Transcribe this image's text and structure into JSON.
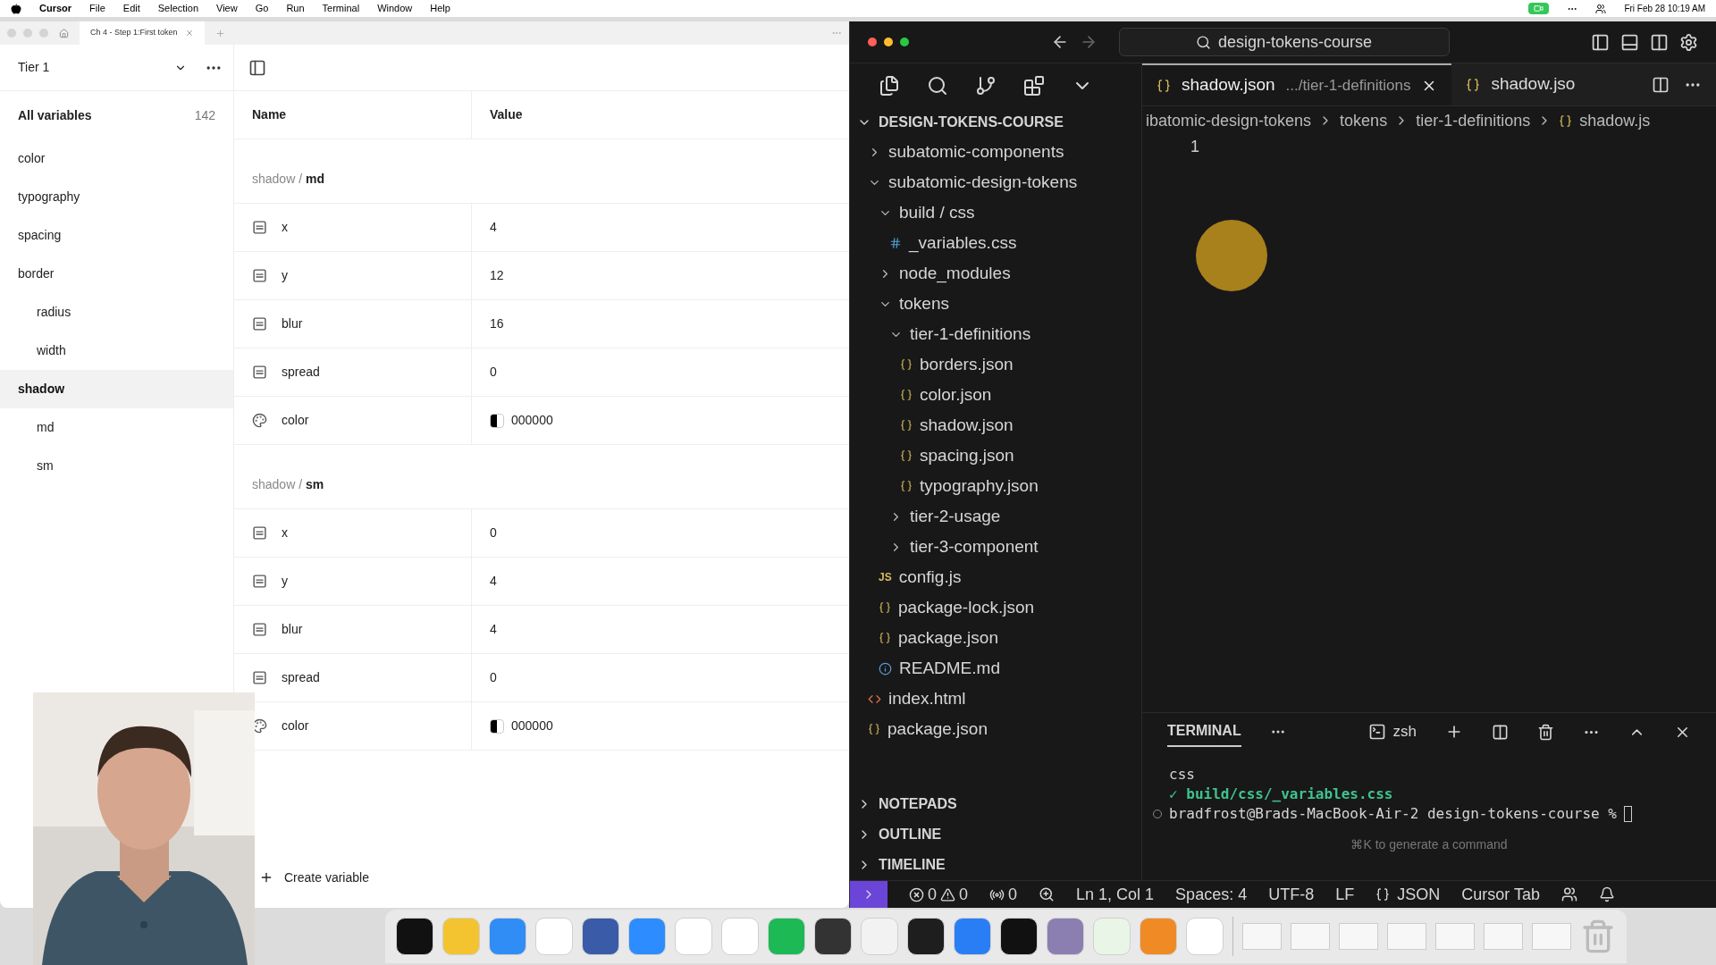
{
  "menu_bar": {
    "app": "Cursor",
    "items": [
      "File",
      "Edit",
      "Selection",
      "View",
      "Go",
      "Run",
      "Terminal",
      "Window",
      "Help"
    ],
    "clock": "Fri Feb 28  10:19 AM"
  },
  "variables_app": {
    "tab_title": "Ch 4 - Step 1:First token",
    "collection": "Tier 1",
    "sidebar": {
      "all_label": "All variables",
      "all_count": "142",
      "groups": [
        {
          "label": "color",
          "selected": false
        },
        {
          "label": "typography",
          "selected": false
        },
        {
          "label": "spacing",
          "selected": false
        },
        {
          "label": "border",
          "selected": false,
          "children": [
            {
              "label": "radius",
              "selected": false
            },
            {
              "label": "width",
              "selected": false
            }
          ]
        },
        {
          "label": "shadow",
          "selected": true,
          "children": [
            {
              "label": "md",
              "selected": false
            },
            {
              "label": "sm",
              "selected": false
            }
          ]
        }
      ]
    },
    "columns": [
      "Name",
      "Value"
    ],
    "groups": [
      {
        "path": "shadow /",
        "name": "md",
        "rows": [
          {
            "kind": "number",
            "name": "x",
            "value": "4"
          },
          {
            "kind": "number",
            "name": "y",
            "value": "12"
          },
          {
            "kind": "number",
            "name": "blur",
            "value": "16"
          },
          {
            "kind": "number",
            "name": "spread",
            "value": "0"
          },
          {
            "kind": "color",
            "name": "color",
            "value": "000000",
            "color": "#000000"
          }
        ]
      },
      {
        "path": "shadow /",
        "name": "sm",
        "rows": [
          {
            "kind": "number",
            "name": "x",
            "value": "0"
          },
          {
            "kind": "number",
            "name": "y",
            "value": "4"
          },
          {
            "kind": "number",
            "name": "blur",
            "value": "4"
          },
          {
            "kind": "number",
            "name": "spread",
            "value": "0"
          },
          {
            "kind": "color",
            "name": "color",
            "value": "000000",
            "color": "#000000"
          }
        ]
      }
    ],
    "create_button": "Create variable"
  },
  "editor": {
    "search": "design-tokens-course",
    "explorer": {
      "root": "DESIGN-TOKENS-COURSE",
      "tree": [
        {
          "kind": "folder",
          "label": "subatomic-components",
          "expanded": false
        },
        {
          "kind": "folder",
          "label": "subatomic-design-tokens",
          "expanded": true,
          "children": [
            {
              "kind": "folder",
              "label": "build / css",
              "expanded": true,
              "children": [
                {
                  "kind": "css",
                  "label": "_variables.css"
                }
              ]
            },
            {
              "kind": "folder",
              "label": "node_modules",
              "expanded": false
            },
            {
              "kind": "folder",
              "label": "tokens",
              "expanded": true,
              "children": [
                {
                  "kind": "folder",
                  "label": "tier-1-definitions",
                  "expanded": true,
                  "children": [
                    {
                      "kind": "json",
                      "label": "borders.json"
                    },
                    {
                      "kind": "json",
                      "label": "color.json"
                    },
                    {
                      "kind": "json",
                      "label": "shadow.json"
                    },
                    {
                      "kind": "json",
                      "label": "spacing.json"
                    },
                    {
                      "kind": "json",
                      "label": "typography.json"
                    }
                  ]
                },
                {
                  "kind": "folder",
                  "label": "tier-2-usage",
                  "expanded": false
                },
                {
                  "kind": "folder",
                  "label": "tier-3-component",
                  "expanded": false
                }
              ]
            },
            {
              "kind": "js",
              "icon_text": "JS",
              "label": "config.js"
            },
            {
              "kind": "json",
              "label": "package-lock.json"
            },
            {
              "kind": "json",
              "label": "package.json"
            },
            {
              "kind": "md",
              "label": "README.md"
            }
          ]
        },
        {
          "kind": "html",
          "label": "index.html"
        },
        {
          "kind": "json",
          "label": "package.json"
        }
      ],
      "sections": [
        "NOTEPADS",
        "OUTLINE",
        "TIMELINE"
      ]
    },
    "tabs": [
      {
        "label": "shadow.json",
        "description": ".../tier-1-definitions",
        "selected": true
      },
      {
        "label": "shadow.jso",
        "selected": false
      }
    ],
    "breadcrumbs": [
      "ibatomic-design-tokens",
      "tokens",
      "tier-1-definitions",
      "shadow.js"
    ],
    "line_numbers": [
      "1"
    ],
    "terminal": {
      "title": "TERMINAL",
      "shell": "zsh",
      "lines": [
        {
          "kind": "plain",
          "text": "css"
        },
        {
          "kind": "success",
          "text": "✓ build/css/_variables.css"
        },
        {
          "kind": "prompt",
          "text": "bradfrost@Brads-MacBook-Air-2 design-tokens-course %"
        }
      ],
      "hint": "⌘K to generate a command"
    },
    "status_bar": {
      "errors": "0",
      "warnings": "0",
      "ports": "0",
      "items": [
        "Ln 1, Col 1",
        "Spaces: 4",
        "UTF-8",
        "LF"
      ],
      "language": "JSON",
      "cursor_tab": "Cursor Tab"
    }
  }
}
